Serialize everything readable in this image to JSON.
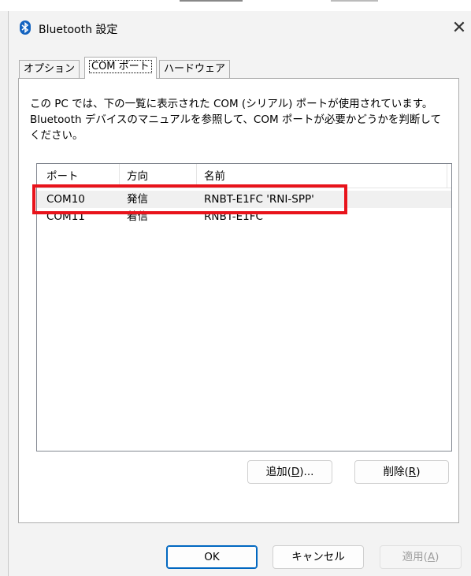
{
  "window": {
    "title": "Bluetooth 設定",
    "close_glyph": "✕"
  },
  "tabs": [
    {
      "label": "オプション",
      "active": false
    },
    {
      "label": "COM ポート",
      "active": true
    },
    {
      "label": "ハードウェア",
      "active": false
    }
  ],
  "description": "この PC では、下の一覧に表示された COM (シリアル) ポートが使用されています。Bluetooth デバイスのマニュアルを参照して、COM ポートが必要かどうかを判断してください。",
  "list": {
    "columns": [
      "ポート",
      "方向",
      "名前"
    ],
    "rows": [
      [
        "COM10",
        "発信",
        "RNBT-E1FC 'RNI-SPP'"
      ],
      [
        "COM11",
        "着信",
        "RNBT-E1FC"
      ]
    ]
  },
  "buttons": {
    "add": {
      "label": "追加(",
      "key": "D",
      "suffix": ")..."
    },
    "delete": {
      "label": "削除(",
      "key": "R",
      "suffix": ")"
    },
    "ok": "OK",
    "cancel": "キャンセル",
    "apply": {
      "label": "適用(",
      "key": "A",
      "suffix": ")"
    }
  },
  "colors": {
    "highlight": "#e8131b",
    "accent": "#0067c0"
  },
  "icons": {
    "title": "bluetooth-icon"
  }
}
